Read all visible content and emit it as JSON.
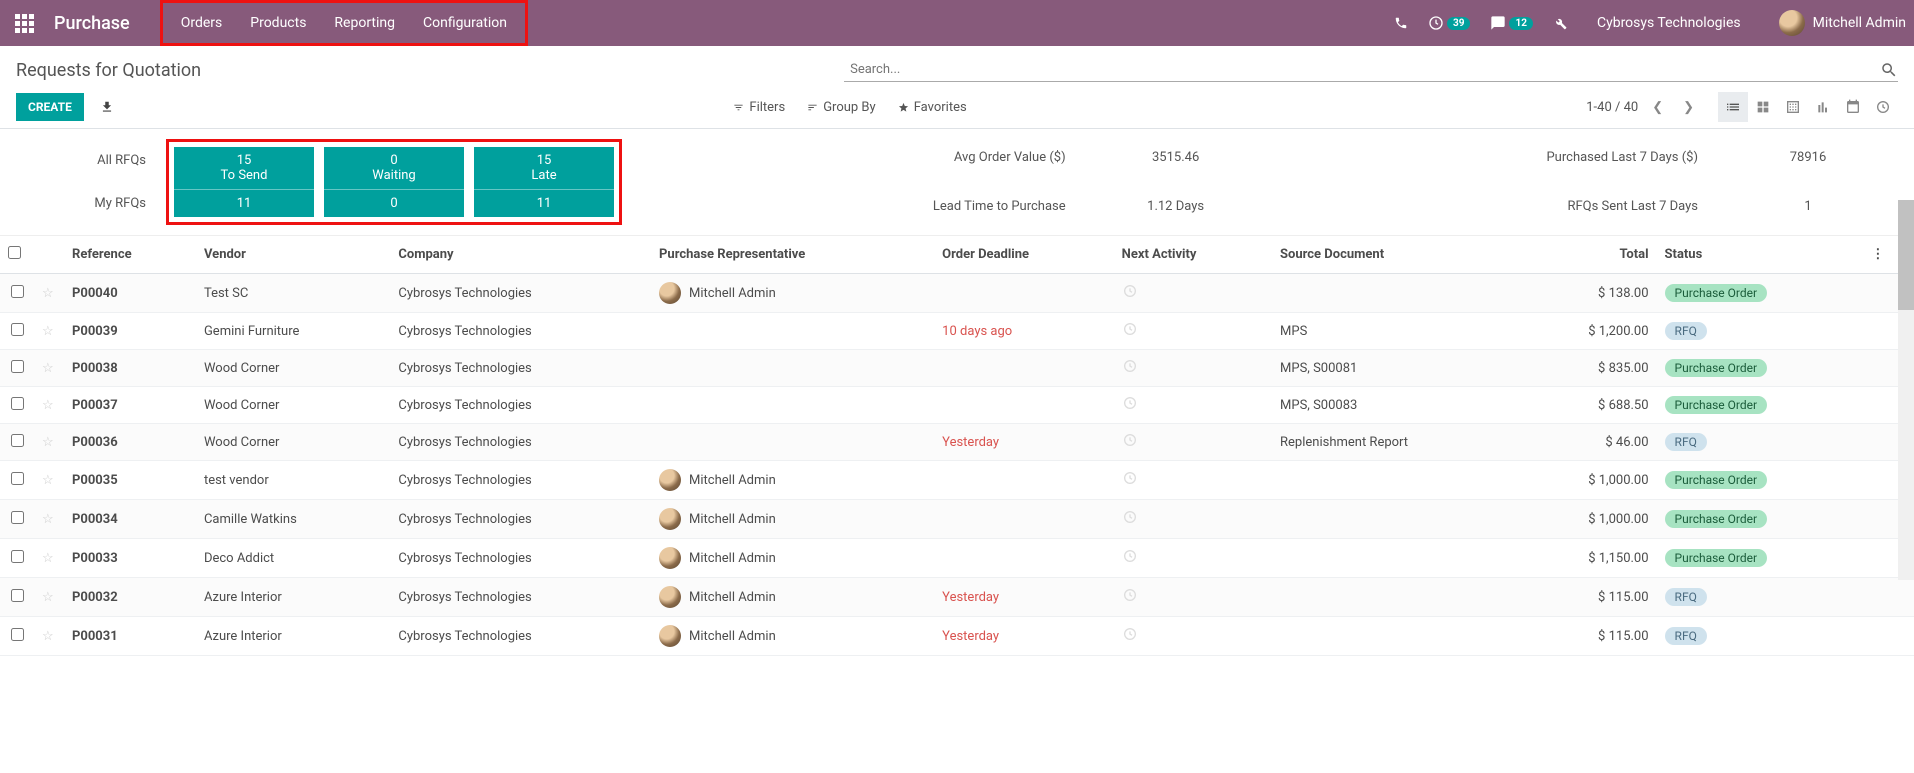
{
  "topbar": {
    "brand": "Purchase",
    "menu": [
      "Orders",
      "Products",
      "Reporting",
      "Configuration"
    ],
    "clock_badge": "39",
    "msg_badge": "12",
    "company": "Cybrosys Technologies",
    "user": "Mitchell Admin"
  },
  "cp": {
    "title": "Requests for Quotation",
    "search_placeholder": "Search...",
    "create": "CREATE",
    "filters": "Filters",
    "groupby": "Group By",
    "favorites": "Favorites",
    "pager": "1-40 / 40"
  },
  "dashboard": {
    "labels": {
      "all": "All RFQs",
      "my": "My RFQs"
    },
    "cards": [
      {
        "top_num": "15",
        "top_lbl": "To Send",
        "bot": "11"
      },
      {
        "top_num": "0",
        "top_lbl": "Waiting",
        "bot": "0"
      },
      {
        "top_num": "15",
        "top_lbl": "Late",
        "bot": "11"
      }
    ],
    "metrics": {
      "avg_lbl": "Avg Order Value ($)",
      "avg_val": "3515.46",
      "lead_lbl": "Lead Time to Purchase",
      "lead_val": "1.12  Days",
      "purch_lbl": "Purchased Last 7 Days ($)",
      "purch_val": "78916",
      "sent_lbl": "RFQs Sent Last 7 Days",
      "sent_val": "1"
    }
  },
  "columns": {
    "reference": "Reference",
    "vendor": "Vendor",
    "company": "Company",
    "rep": "Purchase Representative",
    "deadline": "Order Deadline",
    "activity": "Next Activity",
    "source": "Source Document",
    "total": "Total",
    "status": "Status"
  },
  "status_labels": {
    "po": "Purchase Order",
    "rfq": "RFQ"
  },
  "rows": [
    {
      "ref": "P00040",
      "vendor": "Test SC",
      "company": "Cybrosys Technologies",
      "rep": "Mitchell Admin",
      "deadline": "",
      "dl_red": false,
      "source": "",
      "total": "$ 138.00",
      "status": "po"
    },
    {
      "ref": "P00039",
      "vendor": "Gemini Furniture",
      "company": "Cybrosys Technologies",
      "rep": "",
      "deadline": "10 days ago",
      "dl_red": true,
      "source": "MPS",
      "total": "$ 1,200.00",
      "status": "rfq"
    },
    {
      "ref": "P00038",
      "vendor": "Wood Corner",
      "company": "Cybrosys Technologies",
      "rep": "",
      "deadline": "",
      "dl_red": false,
      "source": "MPS, S00081",
      "total": "$ 835.00",
      "status": "po"
    },
    {
      "ref": "P00037",
      "vendor": "Wood Corner",
      "company": "Cybrosys Technologies",
      "rep": "",
      "deadline": "",
      "dl_red": false,
      "source": "MPS, S00083",
      "total": "$ 688.50",
      "status": "po"
    },
    {
      "ref": "P00036",
      "vendor": "Wood Corner",
      "company": "Cybrosys Technologies",
      "rep": "",
      "deadline": "Yesterday",
      "dl_red": true,
      "source": "Replenishment Report",
      "total": "$ 46.00",
      "status": "rfq"
    },
    {
      "ref": "P00035",
      "vendor": "test vendor",
      "company": "Cybrosys Technologies",
      "rep": "Mitchell Admin",
      "deadline": "",
      "dl_red": false,
      "source": "",
      "total": "$ 1,000.00",
      "status": "po"
    },
    {
      "ref": "P00034",
      "vendor": "Camille Watkins",
      "company": "Cybrosys Technologies",
      "rep": "Mitchell Admin",
      "deadline": "",
      "dl_red": false,
      "source": "",
      "total": "$ 1,000.00",
      "status": "po"
    },
    {
      "ref": "P00033",
      "vendor": "Deco Addict",
      "company": "Cybrosys Technologies",
      "rep": "Mitchell Admin",
      "deadline": "",
      "dl_red": false,
      "source": "",
      "total": "$ 1,150.00",
      "status": "po"
    },
    {
      "ref": "P00032",
      "vendor": "Azure Interior",
      "company": "Cybrosys Technologies",
      "rep": "Mitchell Admin",
      "deadline": "Yesterday",
      "dl_red": true,
      "source": "",
      "total": "$ 115.00",
      "status": "rfq"
    },
    {
      "ref": "P00031",
      "vendor": "Azure Interior",
      "company": "Cybrosys Technologies",
      "rep": "Mitchell Admin",
      "deadline": "Yesterday",
      "dl_red": true,
      "source": "",
      "total": "$ 115.00",
      "status": "rfq"
    }
  ]
}
